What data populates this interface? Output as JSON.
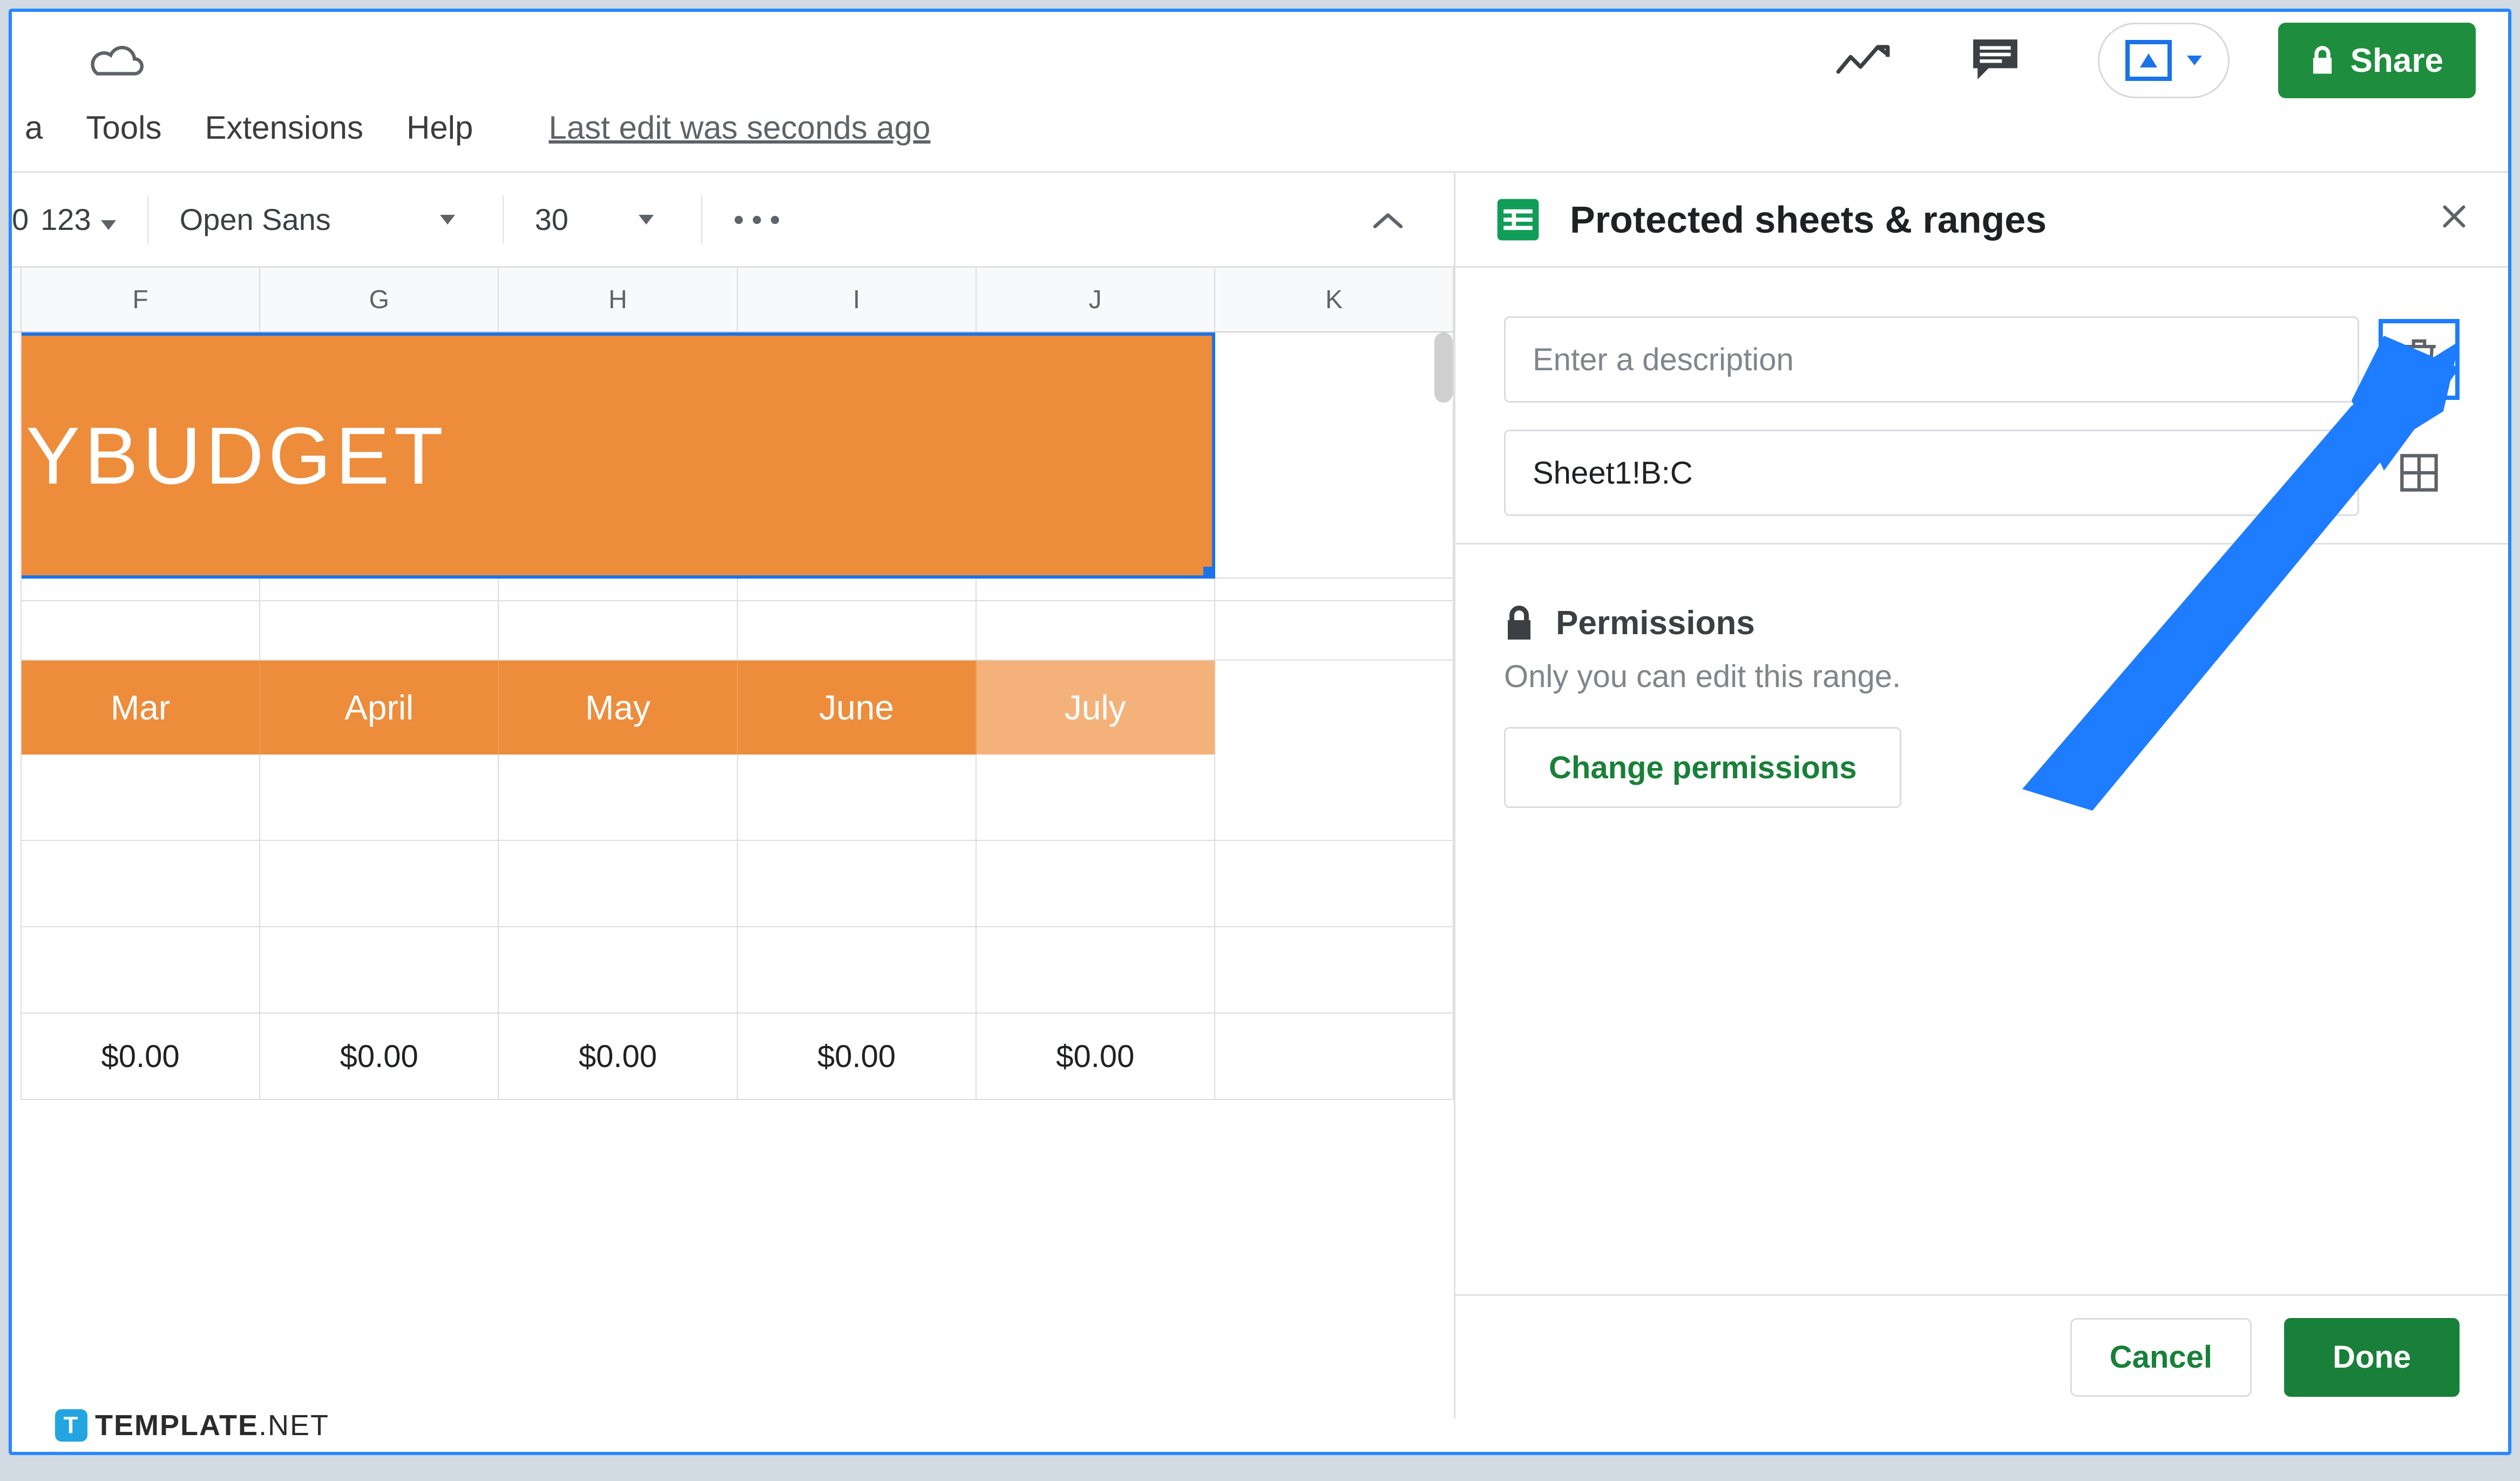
{
  "header": {
    "menus": {
      "trunc": "a",
      "tools": "Tools",
      "extensions": "Extensions",
      "help": "Help"
    },
    "last_edit": "Last edit was seconds ago",
    "share": "Share"
  },
  "toolbar": {
    "num_trunc": "0",
    "numfmt": "123",
    "font": "Open Sans",
    "fontsize": "30",
    "more": "•••"
  },
  "sheet": {
    "columns": [
      "F",
      "G",
      "H",
      "I",
      "J",
      "K"
    ],
    "banner_trunc": "Y",
    "banner": " BUDGET",
    "subheads": [
      "Mar",
      "April",
      "May",
      "June",
      "July"
    ],
    "zeros": [
      "$0.00",
      "$0.00",
      "$0.00",
      "$0.00",
      "$0.00"
    ]
  },
  "sidebar": {
    "title": "Protected sheets & ranges",
    "desc_placeholder": "Enter a description",
    "range_value": "Sheet1!B:C",
    "perm_title": "Permissions",
    "perm_desc": "Only you can edit this range.",
    "change": "Change permissions",
    "cancel": "Cancel",
    "done": "Done"
  },
  "watermark": {
    "bold": "TEMPLATE",
    "rest": ".NET",
    "t": "T"
  }
}
